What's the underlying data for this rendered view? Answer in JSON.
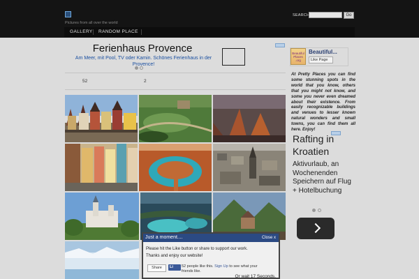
{
  "header": {
    "tagline": "Pictures from all over the world",
    "search_label": "SEARCH:",
    "search_value": "",
    "search_button": "Go"
  },
  "nav": {
    "items": [
      "GALLERY",
      "RANDOM PLACE"
    ]
  },
  "top_ad": {
    "title": "Ferienhaus Provence",
    "description": "Am Meer, mit Pool, TV oder Kamin. Schönes Ferienhaus in der Provence!"
  },
  "counts": {
    "left": "52",
    "right": "2"
  },
  "sidebar": {
    "fb_logo_text": "Beautiful Places .org",
    "fb_page_name": "Beautiful...",
    "fb_like_label": "Like Page",
    "about_text": "At Pretty Places you can find some stunning spots in the world that you know, others that you might not know, and some you never even dreamed about their existence. From easily recognizable buildings and venues to lesser known natural wonders and small towns, you can find them all here. Enjoy!",
    "ad_title": "Rafting in Kroatien",
    "ad_description": "Aktivurlaub, an Wochenenden Speichern auf Flug + Hotelbuchung"
  },
  "popup": {
    "title": "Just a moment....",
    "close_label": "Close x",
    "line1": "Please hit the Like button or share to support our work.",
    "line2": "Thanks and enjoy our website!",
    "share_label": "Share",
    "like_label": "Li",
    "like_count_text": "52 people like this.",
    "signup_link": "Sign Up",
    "signup_text": "to see what your friends like.",
    "wait_text": "Or wait 17 Seconds."
  },
  "colors": {
    "header_bg": "#141414",
    "page_bg": "#dcdcdc",
    "popup_head": "#2b4a83",
    "facebook_blue": "#3b5998"
  }
}
